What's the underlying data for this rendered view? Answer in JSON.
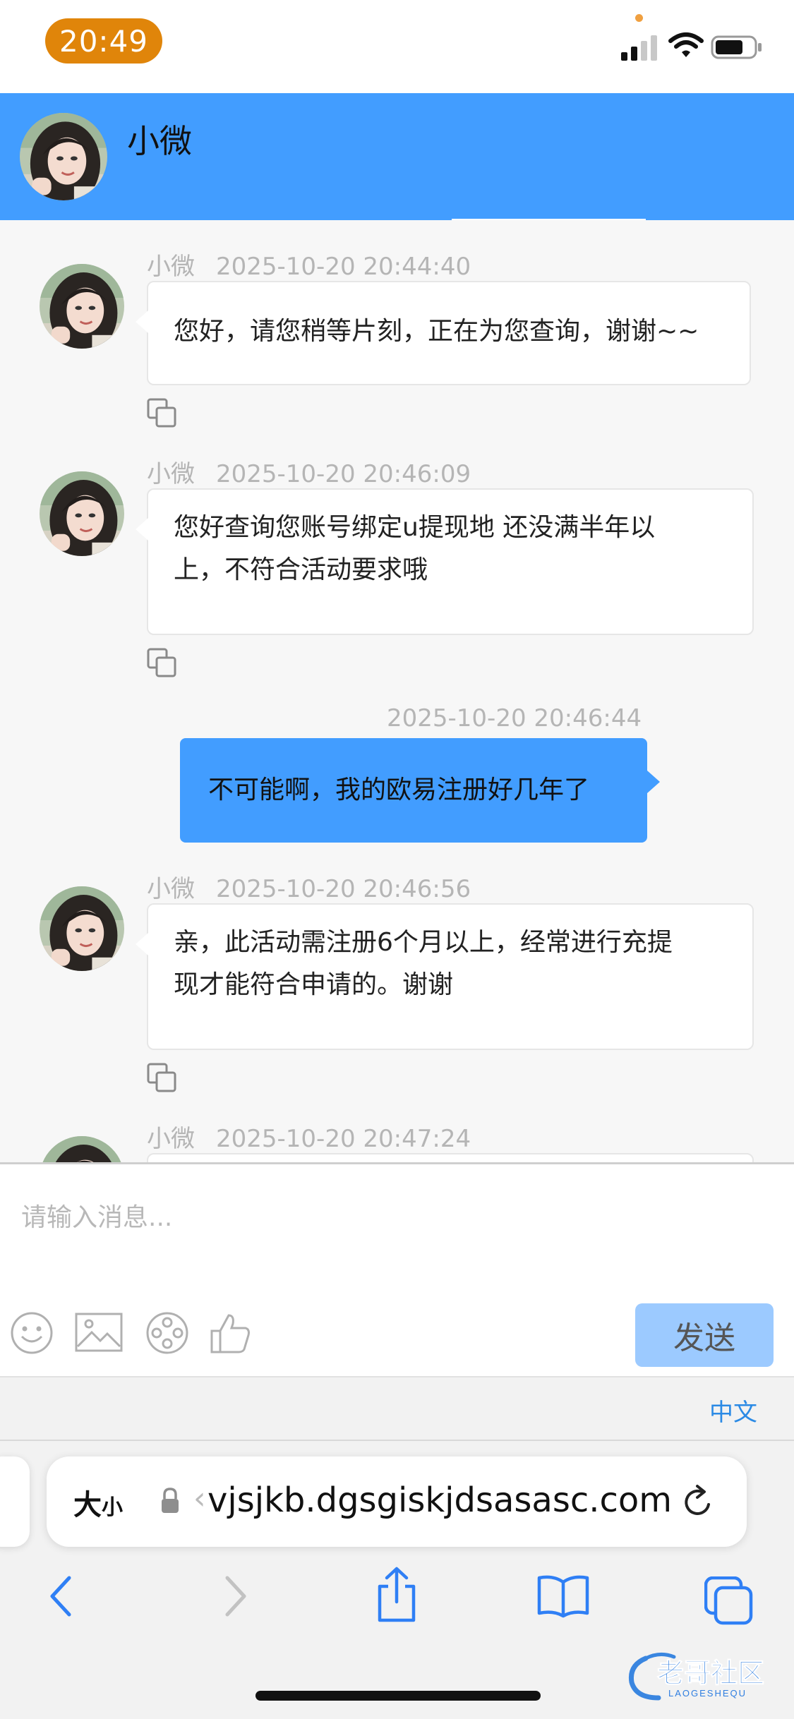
{
  "status_bar": {
    "time": "20:49"
  },
  "header": {
    "title": "小微"
  },
  "messages": [
    {
      "sender": "小微",
      "timestamp": "2025-10-20 20:44:40",
      "text": "您好，请您稍等片刻，正在为您查询，谢谢~~"
    },
    {
      "sender": "小微",
      "timestamp": "2025-10-20 20:46:09",
      "lines": [
        "您好查询您账号绑定u提现地 还没满半年以",
        "上，不符合活动要求哦"
      ]
    },
    {
      "timestamp": "2025-10-20 20:46:44",
      "text": "不可能啊，我的欧易注册好几年了"
    },
    {
      "sender": "小微",
      "timestamp": "2025-10-20 20:46:56",
      "lines": [
        "亲，此活动需注册6个月以上，经常进行充提",
        "现才能符合申请的。谢谢"
      ]
    },
    {
      "sender": "小微",
      "timestamp": "2025-10-20 20:47:24"
    }
  ],
  "input": {
    "placeholder": "请输入消息...",
    "value": ""
  },
  "toolbar": {
    "send_label": "发送",
    "icons": [
      "emoji-icon",
      "image-icon",
      "video-icon",
      "thumbs-up-icon"
    ]
  },
  "lang_switch": {
    "label": "中文"
  },
  "browser": {
    "size_label": "大",
    "size_label_small": "小",
    "url_fade": "‹",
    "url": "vjsjkb.dgsgiskjdsasasc.com",
    "nav_icons": [
      "back-icon",
      "forward-icon",
      "share-icon",
      "bookmarks-icon",
      "tabs-icon"
    ]
  },
  "watermark": {
    "text": "老哥社区",
    "subtext": "LAOGESHEQU"
  },
  "colors": {
    "brand_blue": "#429dff",
    "send_disabled": "#9ccaff",
    "time_pill": "#e0850a",
    "link_blue": "#2b8ae5"
  }
}
